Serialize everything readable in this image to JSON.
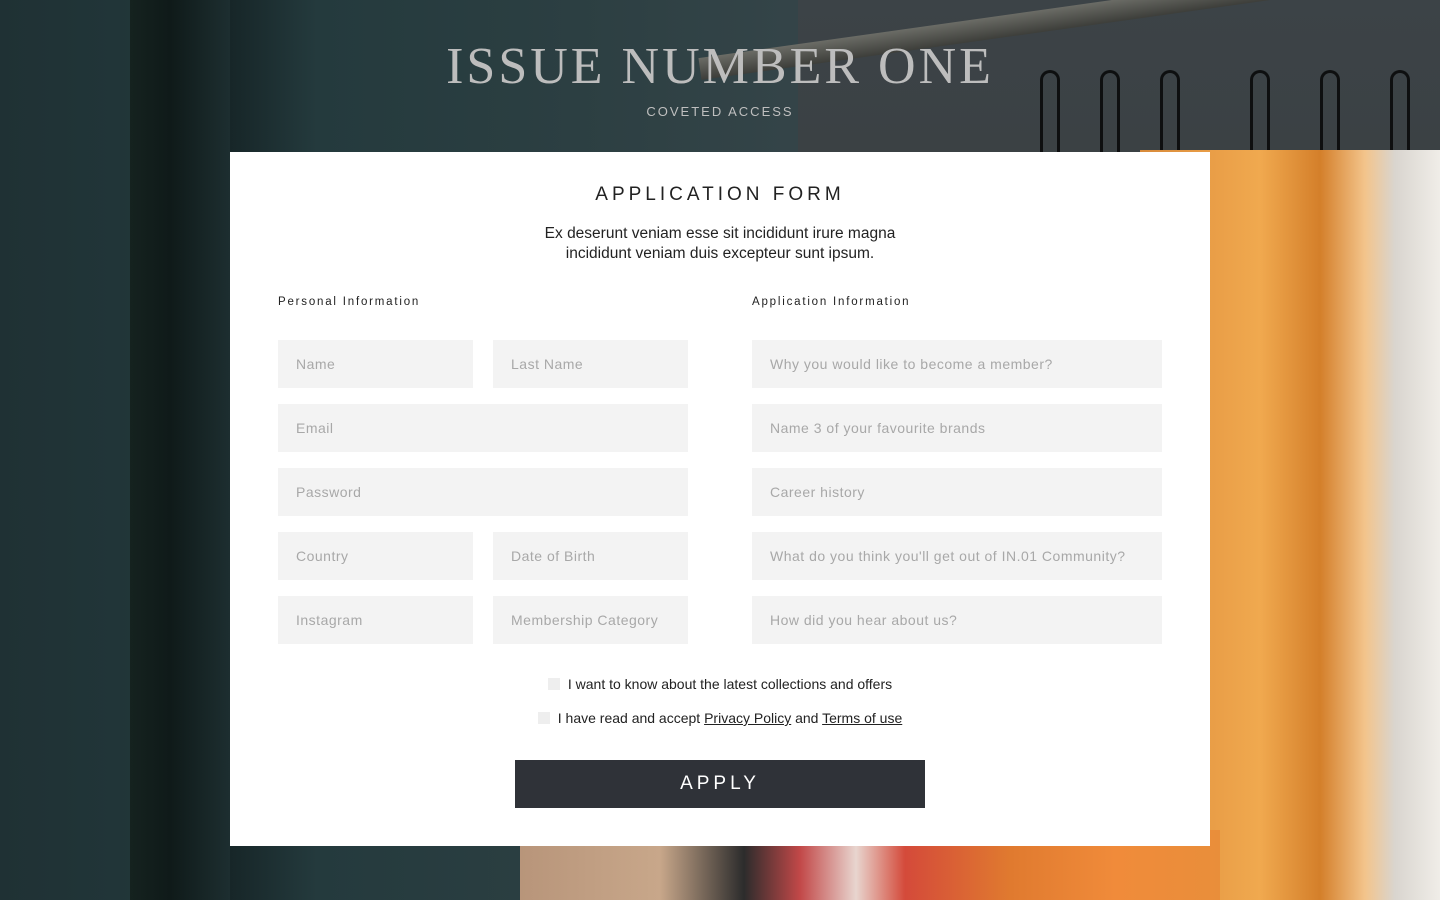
{
  "brand": {
    "title": "ISSUE NUMBER ONE",
    "subtitle": "COVETED ACCESS"
  },
  "form": {
    "title": "APPLICATION FORM",
    "description": "Ex deserunt veniam esse sit incididunt irure magna incididunt veniam duis excepteur sunt ipsum.",
    "personal_section_title": "Personal Information",
    "application_section_title": "Application Information",
    "personal_fields": {
      "name": "Name",
      "last_name": "Last Name",
      "email": "Email",
      "password": "Password",
      "country": "Country",
      "date_of_birth": "Date of Birth",
      "instagram": "Instagram",
      "membership_category": "Membership Category"
    },
    "application_fields": {
      "why_member": "Why you would like to become a member?",
      "favourite_brands": "Name 3 of your favourite brands",
      "career_history": "Career history",
      "community_benefit": "What do you think you'll get out of IN.01 Community?",
      "hear_about": "How did you hear about us?"
    },
    "newsletter_label": "I want to know about the latest collections and offers",
    "terms_prefix": "I have read and accept",
    "privacy_link": "Privacy Policy",
    "terms_and": "and",
    "terms_link": "Terms of use",
    "apply_label": "APPLY"
  },
  "colors": {
    "button_bg": "#2f3238",
    "field_bg": "#f3f3f3",
    "card_bg": "#ffffff"
  }
}
